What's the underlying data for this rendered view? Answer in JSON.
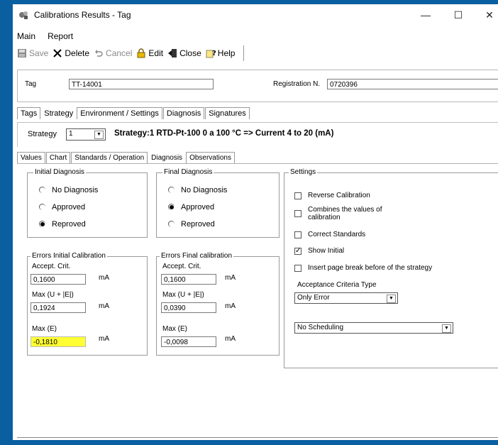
{
  "window": {
    "title": "Calibrations Results - Tag",
    "minimize": "—",
    "maximize": "☐",
    "close": "✕"
  },
  "menu": {
    "items": [
      "Main",
      "Report"
    ]
  },
  "toolbar": {
    "save": "Save",
    "delete": "Delete",
    "cancel": "Cancel",
    "edit": "Edit",
    "close": "Close",
    "help": "Help"
  },
  "tag": {
    "label": "Tag",
    "value": "TT-14001",
    "reg_label": "Registration N.",
    "reg_value": "0720396"
  },
  "tabs_top": [
    "Tags",
    "Strategy",
    "Environment / Settings",
    "Diagnosis",
    "Signatures"
  ],
  "strategy": {
    "label": "Strategy",
    "value": "1",
    "description": "Strategy:1  RTD-Pt-100  0  a  100  °C => Current  4  to  20  (mA)"
  },
  "tabs_inner": [
    "Values",
    "Chart",
    "Standards / Operation",
    "Diagnosis",
    "Observations"
  ],
  "initial_diagnosis": {
    "title": "Initial Diagnosis",
    "options": [
      "No Diagnosis",
      "Approved",
      "Reproved"
    ],
    "selected": "Reproved"
  },
  "final_diagnosis": {
    "title": "Final Diagnosis",
    "options": [
      "No Diagnosis",
      "Approved",
      "Reproved"
    ],
    "selected": "Approved"
  },
  "errors_initial": {
    "title": "Errors Initial Calibration",
    "accept_label": "Accept. Crit.",
    "accept_value": "0,1600",
    "maxu_label": "Max (U + |E|)",
    "maxu_value": "0,1924",
    "maxe_label": "Max (E)",
    "maxe_value": "-0,1810",
    "unit": "mA",
    "highlight_color": "#ffff33"
  },
  "errors_final": {
    "title": "Errors Final calibration",
    "accept_label": "Accept. Crit.",
    "accept_value": "0,1600",
    "maxu_label": "Max (U + |E|)",
    "maxu_value": "0,0390",
    "maxe_label": "Max (E)",
    "maxe_value": "-0,0098",
    "unit": "mA"
  },
  "settings": {
    "title": "Settings",
    "checks": [
      {
        "label": "Reverse Calibration",
        "checked": false
      },
      {
        "label": "Combines the values of",
        "label2": "calibration",
        "checked": false
      },
      {
        "label": "Correct Standards",
        "checked": false
      },
      {
        "label": "Show Initial",
        "checked": true
      },
      {
        "label": "Insert page break before of the strategy",
        "checked": false
      }
    ],
    "criteria_label": "Acceptance Criteria Type",
    "criteria_value": "Only Error",
    "scheduling_value": "No Scheduling"
  },
  "colors": {
    "frame": "#0a5fa0",
    "highlight": "#ffff33"
  }
}
